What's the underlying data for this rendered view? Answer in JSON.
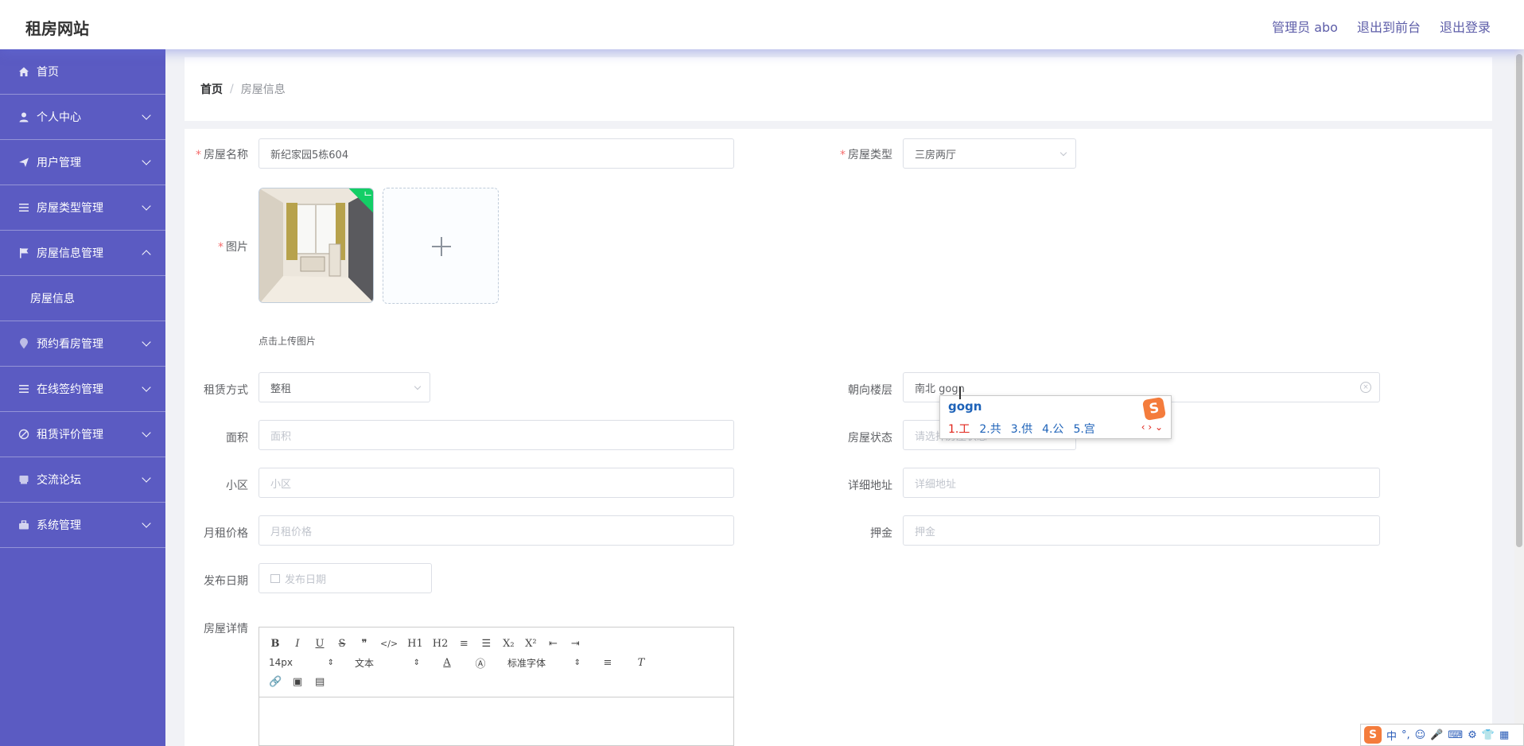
{
  "header": {
    "brand": "租房网站",
    "links": [
      "管理员 abo",
      "退出到前台",
      "退出登录"
    ]
  },
  "sidebar": {
    "items": [
      {
        "label": "首页",
        "icon": "home-icon"
      },
      {
        "label": "个人中心",
        "icon": "user-icon"
      },
      {
        "label": "用户管理",
        "icon": "send-icon"
      },
      {
        "label": "房屋类型管理",
        "icon": "list-icon"
      },
      {
        "label": "房屋信息管理",
        "icon": "flag-icon"
      },
      {
        "label": "预约看房管理",
        "icon": "location-icon"
      },
      {
        "label": "在线签约管理",
        "icon": "list-icon"
      },
      {
        "label": "租赁评价管理",
        "icon": "comment-icon"
      },
      {
        "label": "交流论坛",
        "icon": "chat-icon"
      },
      {
        "label": "系统管理",
        "icon": "toolbox-icon"
      }
    ],
    "submenu_label": "房屋信息"
  },
  "breadcrumb": {
    "home": "首页",
    "separator": "/",
    "current": "房屋信息"
  },
  "form": {
    "name_label": "房屋名称",
    "name_value": "新纪家园5栋604",
    "type_label": "房屋类型",
    "type_value": "三房两厅",
    "image_label": "图片",
    "upload_tip": "点击上传图片",
    "lease_label": "租赁方式",
    "lease_value": "整租",
    "orient_label": "朝向楼层",
    "orient_value": "南北 gogn",
    "area_label": "面积",
    "area_placeholder": "面积",
    "status_label": "房屋状态",
    "status_placeholder": "请选择房屋状态",
    "community_label": "小区",
    "community_placeholder": "小区",
    "address_label": "详细地址",
    "address_placeholder": "详细地址",
    "rent_label": "月租价格",
    "rent_placeholder": "月租价格",
    "deposit_label": "押金",
    "deposit_placeholder": "押金",
    "date_label": "发布日期",
    "date_placeholder": "发布日期",
    "detail_label": "房屋详情"
  },
  "editor": {
    "row1": [
      "B",
      "I",
      "U",
      "S",
      "❞",
      "</>",
      "H1",
      "H2",
      "≡",
      "☰",
      "X₂",
      "X²",
      "⇤",
      "⇥"
    ],
    "size": "14px",
    "heading": "文本",
    "font": "标准字体",
    "row3": [
      "🔗",
      "▣",
      "▤"
    ]
  },
  "ime": {
    "composition": "gogn",
    "candidates": [
      "1.工",
      "2.共",
      "3.供",
      "4.公",
      "5.宫"
    ],
    "logo": "S"
  },
  "ime_bar": {
    "logo": "S",
    "mode": "中"
  },
  "colors": {
    "sidebar": "#5b5bc2",
    "accent": "#5d5da8",
    "success": "#13ce66",
    "required": "#f56c6c"
  }
}
